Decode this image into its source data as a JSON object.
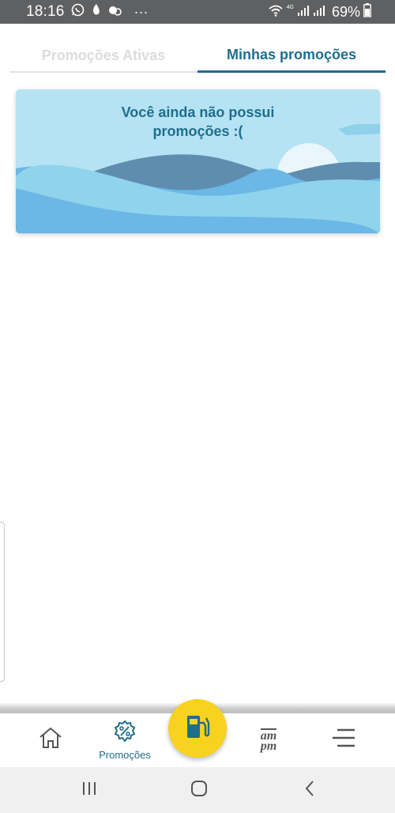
{
  "status_bar": {
    "time": "18:16",
    "network_tag": "4G",
    "battery": "69%",
    "more_dots": "···",
    "icons": [
      "whatsapp-icon",
      "notification-icon",
      "notification-icon-2",
      "wifi-icon",
      "signal-icon",
      "signal-icon-2",
      "battery-icon"
    ]
  },
  "tabs": [
    {
      "label": "Promoções Ativas",
      "active": false
    },
    {
      "label": "Minhas promoções",
      "active": true
    }
  ],
  "empty_state": {
    "line1": "Você ainda não possui",
    "line2": "promoções :("
  },
  "bottom_nav": {
    "items": [
      {
        "icon": "home-icon",
        "label": ""
      },
      {
        "icon": "percent-badge-icon",
        "label": "Promoções"
      },
      {
        "icon": "fuel-pump-icon",
        "label": ""
      },
      {
        "icon": "ampm-logo-icon",
        "label": ""
      },
      {
        "icon": "menu-icon",
        "label": ""
      }
    ],
    "logo_text": {
      "top": "am",
      "bottom": "pm"
    }
  },
  "system_nav": {
    "icons": [
      "recents-icon",
      "home-circle-icon",
      "back-icon"
    ]
  },
  "colors": {
    "accent": "#1f6e8c",
    "fuel_button": "#f7d21f",
    "status_bar": "#5f6061",
    "sky": "#b5e3f3"
  }
}
